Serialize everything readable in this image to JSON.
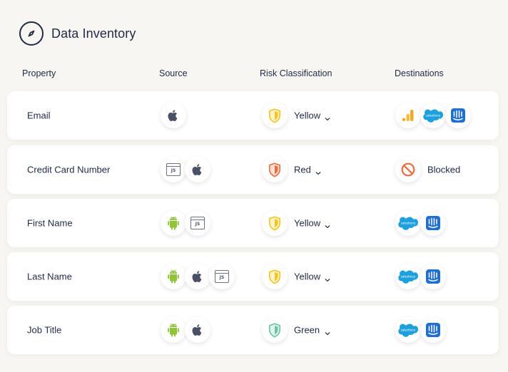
{
  "header": {
    "title": "Data Inventory",
    "icon": "compass-icon"
  },
  "columns": {
    "property": "Property",
    "source": "Source",
    "risk": "Risk Classification",
    "destinations": "Destinations"
  },
  "colors": {
    "yellow_shield": "#f5c518",
    "red_shield": "#f06a3c",
    "green_shield": "#6cc3a7",
    "android": "#8fc43a",
    "apple": "#4a5166",
    "salesforce": "#1ea0dc",
    "intercom": "#1f6fd1",
    "analytics_orange": "#f5a623",
    "blocked": "#f06a3c"
  },
  "rows": [
    {
      "property": "Email",
      "sources": [
        "apple-icon"
      ],
      "risk": "Yellow",
      "destinations": [
        "google-analytics-icon",
        "salesforce-icon",
        "intercom-icon"
      ],
      "blocked_label": ""
    },
    {
      "property": "Credit Card Number",
      "sources": [
        "javascript-icon",
        "apple-icon"
      ],
      "risk": "Red",
      "destinations": [
        "blocked-icon"
      ],
      "blocked_label": "Blocked"
    },
    {
      "property": "First Name",
      "sources": [
        "android-icon",
        "javascript-icon"
      ],
      "risk": "Yellow",
      "destinations": [
        "salesforce-icon",
        "intercom-icon"
      ],
      "blocked_label": ""
    },
    {
      "property": "Last Name",
      "sources": [
        "android-icon",
        "apple-icon",
        "javascript-icon"
      ],
      "risk": "Yellow",
      "destinations": [
        "salesforce-icon",
        "intercom-icon"
      ],
      "blocked_label": ""
    },
    {
      "property": "Job Title",
      "sources": [
        "android-icon",
        "apple-icon"
      ],
      "risk": "Green",
      "destinations": [
        "salesforce-icon",
        "intercom-icon"
      ],
      "blocked_label": ""
    }
  ],
  "js_badge": "JS",
  "salesforce_badge": "salesforce"
}
